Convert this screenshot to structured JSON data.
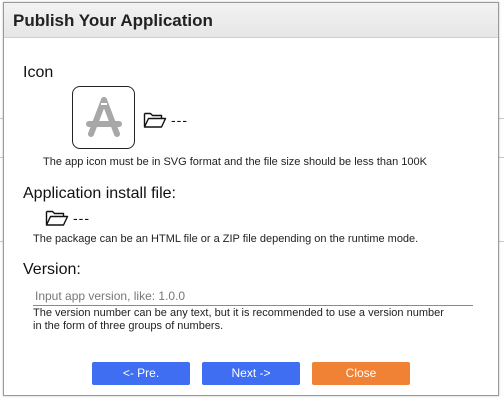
{
  "dialog": {
    "title": "Publish Your Application"
  },
  "icon_section": {
    "label": "Icon",
    "icon_name": "app-store-icon",
    "path_placeholder": "---",
    "note": "The app icon must be in SVG format and the file size should be less than 100K"
  },
  "install_section": {
    "label": "Application install file:",
    "path_placeholder": "---",
    "note": "The package can be an HTML file or a ZIP file depending on the runtime mode."
  },
  "version_section": {
    "label": "Version:",
    "input_value": "",
    "input_placeholder": "Input app version, like: 1.0.0",
    "note": "The version number can be any text, but it is recommended to use a version number in the form of three groups of numbers."
  },
  "buttons": {
    "prev_label": "<- Pre.",
    "next_label": "Next ->",
    "close_label": "Close"
  },
  "colors": {
    "primary": "#3f6ef2",
    "accent": "#f08236"
  }
}
